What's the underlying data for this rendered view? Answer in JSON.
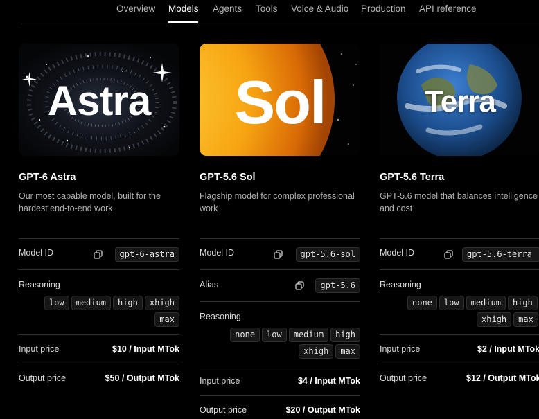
{
  "nav": {
    "tabs": [
      "Overview",
      "Models",
      "Agents",
      "Tools",
      "Voice & Audio",
      "Production",
      "API reference"
    ],
    "active": "Models"
  },
  "labels": {
    "model_id": "Model ID",
    "alias": "Alias",
    "reasoning": "Reasoning",
    "input_price": "Input price",
    "output_price": "Output price"
  },
  "icons": {
    "copy": "copy-icon"
  },
  "models": [
    {
      "hero_text": "Astra",
      "name": "GPT-6 Astra",
      "description": "Our most capable model, built for the hardest end-to-end work",
      "model_id": "gpt-6-astra",
      "reasoning": [
        "low",
        "medium",
        "high",
        "xhigh",
        "max"
      ],
      "input_price": "$10 / Input MTok",
      "output_price": "$50 / Output MTok"
    },
    {
      "hero_text": "Sol",
      "name": "GPT-5.6 Sol",
      "description": "Flagship model for complex professional work",
      "model_id": "gpt-5.6-sol",
      "alias": "gpt-5.6",
      "reasoning": [
        "none",
        "low",
        "medium",
        "high",
        "xhigh",
        "max"
      ],
      "input_price": "$4 / Input MTok",
      "output_price": "$20 / Output MTok"
    },
    {
      "hero_text": "Terra",
      "name": "GPT-5.6 Terra",
      "description": "GPT-5.6 model that balances intelligence and cost",
      "model_id": "gpt-5.6-terra",
      "reasoning": [
        "none",
        "low",
        "medium",
        "high",
        "xhigh",
        "max"
      ],
      "input_price": "$2 / Input MTok",
      "output_price": "$12 / Output MTok"
    }
  ]
}
